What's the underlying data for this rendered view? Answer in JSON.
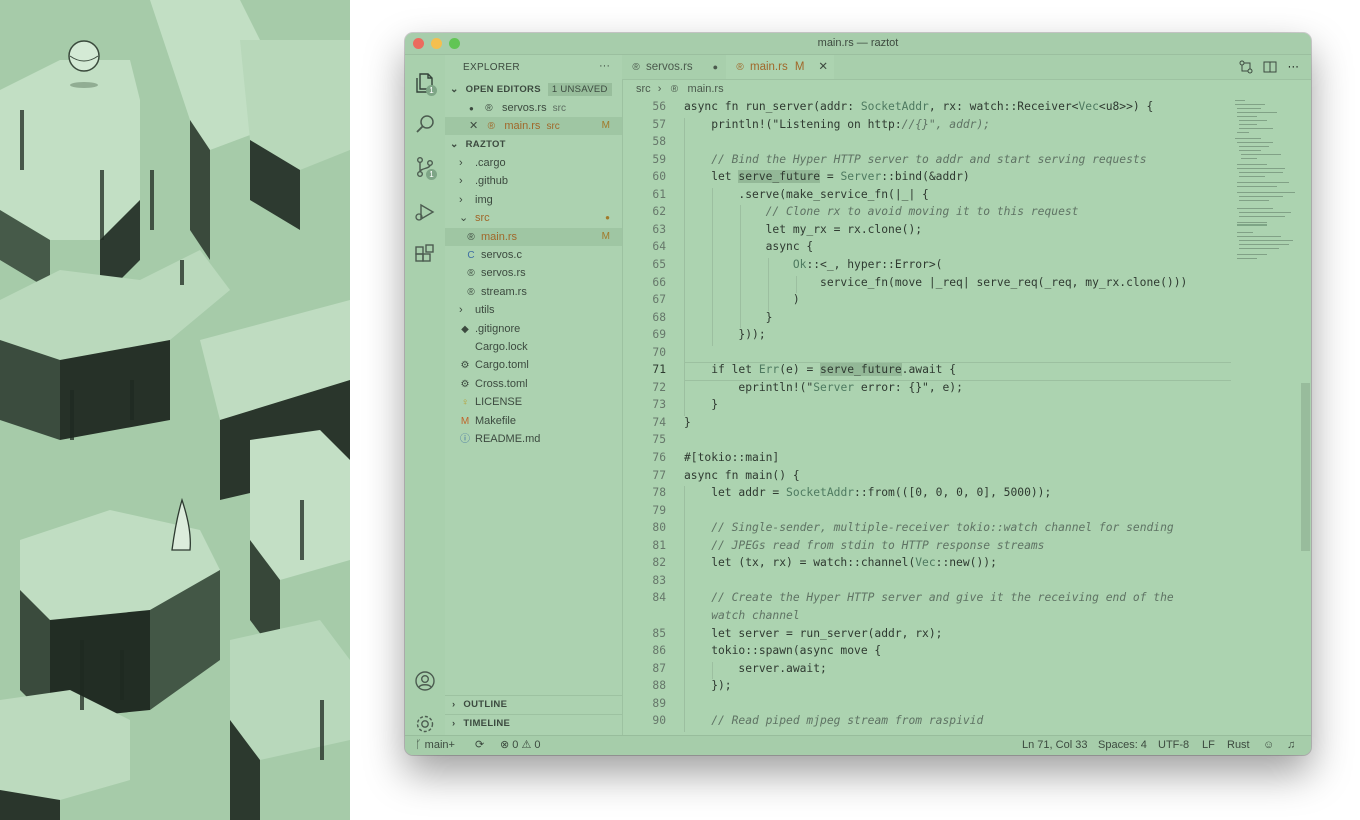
{
  "window": {
    "title": "main.rs — raztot",
    "traffic_lights": {
      "close": "#ec6b5e",
      "minimize": "#f4bf4f",
      "maximize": "#61c554"
    }
  },
  "activity_bar": {
    "icons": [
      "files-icon",
      "search-icon",
      "source-control-icon",
      "run-debug-icon",
      "extensions-icon",
      "account-icon",
      "gear-icon"
    ],
    "files_badge": "1",
    "scm_badge": "1"
  },
  "sidebar": {
    "title": "EXPLORER",
    "more": "···",
    "open_editors": {
      "label": "OPEN EDITORS",
      "badge": "1 UNSAVED",
      "items": [
        {
          "marker": "●",
          "icon": "rust-icon",
          "name": "servos.rs",
          "dir": "src",
          "status": ""
        },
        {
          "marker": "✕",
          "icon": "rust-icon",
          "name": "main.rs",
          "dir": "src",
          "status": "M"
        }
      ]
    },
    "project": {
      "label": "RAZTOT",
      "tree": [
        {
          "chevron": "›",
          "name": ".cargo",
          "icon": "",
          "status": ""
        },
        {
          "chevron": "›",
          "name": ".github",
          "icon": "",
          "status": ""
        },
        {
          "chevron": "›",
          "name": "img",
          "icon": "",
          "status": ""
        },
        {
          "chevron": "⌄",
          "name": "src",
          "icon": "",
          "status": "●"
        },
        {
          "chevron": "",
          "name": "main.rs",
          "icon": "rust-icon",
          "status": "M"
        },
        {
          "chevron": "",
          "name": "servos.c",
          "icon": "c-icon",
          "status": ""
        },
        {
          "chevron": "",
          "name": "servos.rs",
          "icon": "rust-icon",
          "status": ""
        },
        {
          "chevron": "",
          "name": "stream.rs",
          "icon": "rust-icon",
          "status": ""
        },
        {
          "chevron": "›",
          "name": "utils",
          "icon": "",
          "status": ""
        },
        {
          "chevron": "",
          "name": ".gitignore",
          "icon": "git-icon",
          "status": ""
        },
        {
          "chevron": "",
          "name": "Cargo.lock",
          "icon": "",
          "status": ""
        },
        {
          "chevron": "",
          "name": "Cargo.toml",
          "icon": "gear-file-icon",
          "status": ""
        },
        {
          "chevron": "",
          "name": "Cross.toml",
          "icon": "gear-file-icon",
          "status": ""
        },
        {
          "chevron": "",
          "name": "LICENSE",
          "icon": "license-icon",
          "status": ""
        },
        {
          "chevron": "",
          "name": "Makefile",
          "icon": "makefile-icon",
          "status": ""
        },
        {
          "chevron": "",
          "name": "README.md",
          "icon": "info-icon",
          "status": ""
        }
      ]
    },
    "outline": "OUTLINE",
    "timeline": "TIMELINE"
  },
  "tabs": [
    {
      "name": "servos.rs",
      "dirty": "●",
      "status": "",
      "active": false
    },
    {
      "name": "main.rs",
      "dirty": "",
      "status": "M",
      "close": "✕",
      "active": true
    }
  ],
  "breadcrumb": {
    "folder": "src",
    "sep": "›",
    "file": "main.rs"
  },
  "editor": {
    "lines": [
      {
        "n": "56",
        "text": "async fn run_server(addr: SocketAddr, rx: watch::Receiver<Vec<u8>>) {"
      },
      {
        "n": "57",
        "text": "    println!(\"Listening on http://{}\", addr);"
      },
      {
        "n": "58",
        "text": ""
      },
      {
        "n": "59",
        "text": "    // Bind the Hyper HTTP server to addr and start serving requests"
      },
      {
        "n": "60",
        "text": "    let serve_future = Server::bind(&addr)"
      },
      {
        "n": "61",
        "text": "        .serve(make_service_fn(|_| {"
      },
      {
        "n": "62",
        "text": "            // Clone rx to avoid moving it to this request"
      },
      {
        "n": "63",
        "text": "            let my_rx = rx.clone();"
      },
      {
        "n": "64",
        "text": "            async {"
      },
      {
        "n": "65",
        "text": "                Ok::<_, hyper::Error>("
      },
      {
        "n": "66",
        "text": "                    service_fn(move |_req| serve_req(_req, my_rx.clone()))"
      },
      {
        "n": "67",
        "text": "                )"
      },
      {
        "n": "68",
        "text": "            }"
      },
      {
        "n": "69",
        "text": "        }));"
      },
      {
        "n": "70",
        "text": ""
      },
      {
        "n": "71",
        "text": "    if let Err(e) = serve_future.await {"
      },
      {
        "n": "72",
        "text": "        eprintln!(\"Server error: {}\", e);"
      },
      {
        "n": "73",
        "text": "    }"
      },
      {
        "n": "74",
        "text": "}"
      },
      {
        "n": "75",
        "text": ""
      },
      {
        "n": "76",
        "text": "#[tokio::main]"
      },
      {
        "n": "77",
        "text": "async fn main() {"
      },
      {
        "n": "78",
        "text": "    let addr = SocketAddr::from(([0, 0, 0, 0], 5000));"
      },
      {
        "n": "79",
        "text": ""
      },
      {
        "n": "80",
        "text": "    // Single-sender, multiple-receiver tokio::watch channel for sending"
      },
      {
        "n": "81",
        "text": "    // JPEGs read from stdin to HTTP response streams"
      },
      {
        "n": "82",
        "text": "    let (tx, rx) = watch::channel(Vec::new());"
      },
      {
        "n": "83",
        "text": ""
      },
      {
        "n": "84",
        "text": "    // Create the Hyper HTTP server and give it the receiving end of the"
      },
      {
        "n": "",
        "text": "    watch channel"
      },
      {
        "n": "85",
        "text": "    let server = run_server(addr, rx);"
      },
      {
        "n": "86",
        "text": "    tokio::spawn(async move {"
      },
      {
        "n": "87",
        "text": "        server.await;"
      },
      {
        "n": "88",
        "text": "    });"
      },
      {
        "n": "89",
        "text": ""
      },
      {
        "n": "90",
        "text": "    // Read piped mjpeg stream from raspivid"
      }
    ],
    "current_line": "71",
    "highlight_word": "serve_future"
  },
  "status_bar": {
    "branch": "main+",
    "sync": "⟳",
    "errors": "0",
    "warnings": "0",
    "position": "Ln 71, Col 33",
    "spaces": "Spaces: 4",
    "encoding": "UTF-8",
    "eol": "LF",
    "language": "Rust"
  },
  "colors": {
    "editor_bg": "#acd3b0",
    "accent_modified": "#a0682a",
    "artwork_bg": "#a6cba9"
  }
}
